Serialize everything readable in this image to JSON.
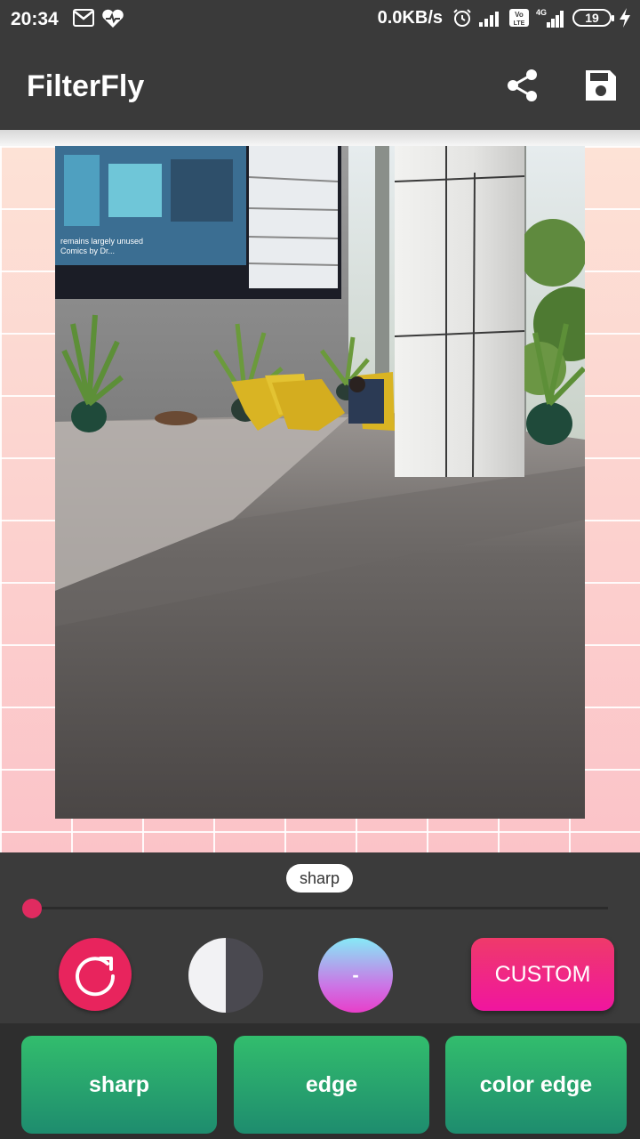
{
  "status_bar": {
    "time": "20:34",
    "network_speed": "0.0KB/s",
    "battery_level": "19",
    "icons_left": [
      "gmail-icon",
      "health-heart-icon"
    ],
    "icons_right": [
      "alarm-icon",
      "signal-icon",
      "volte-icon",
      "4g-signal-icon",
      "battery-icon",
      "charging-icon"
    ]
  },
  "app_bar": {
    "title": "FilterFly",
    "actions": [
      "share-icon",
      "save-icon"
    ]
  },
  "photo": {
    "screen_caption_line1": "remains largely unused",
    "screen_caption_line2": "Comics by Dr...",
    "description_colors": {
      "floor": "#5f5b5a",
      "wall": "#8d8d8d",
      "chairs": "#e0bf2a"
    }
  },
  "controls": {
    "current_filter_label": "sharp",
    "slider_value_fraction": 0,
    "gradient_button_label": "-",
    "custom_button_label": "CUSTOM",
    "accent_color": "#e8245d"
  },
  "filters": [
    {
      "label": "sharp"
    },
    {
      "label": "edge"
    },
    {
      "label": "color edge"
    }
  ]
}
